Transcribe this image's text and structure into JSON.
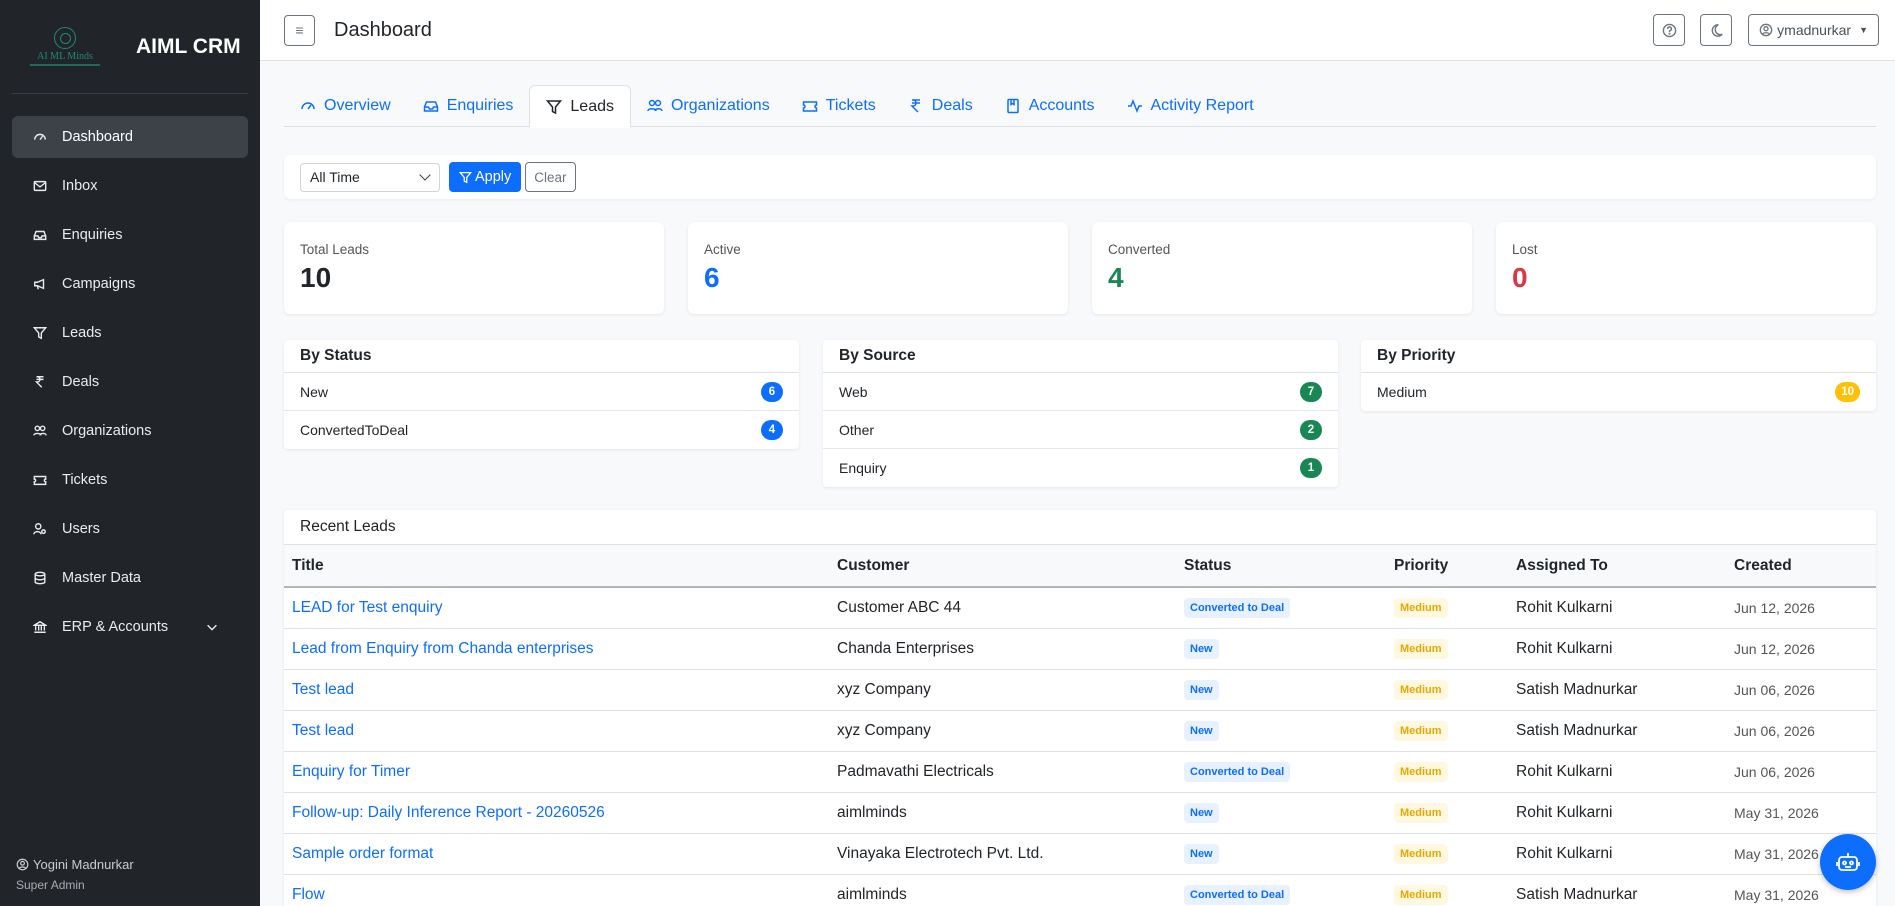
{
  "brand": {
    "logo_text": "AI ML Minds",
    "title": "AIML CRM"
  },
  "sidebar": {
    "items": [
      {
        "label": "Dashboard",
        "icon": "gauge-icon"
      },
      {
        "label": "Inbox",
        "icon": "envelope-icon"
      },
      {
        "label": "Enquiries",
        "icon": "inbox-tray-icon"
      },
      {
        "label": "Campaigns",
        "icon": "megaphone-icon"
      },
      {
        "label": "Leads",
        "icon": "funnel-icon"
      },
      {
        "label": "Deals",
        "icon": "rupee-icon"
      },
      {
        "label": "Organizations",
        "icon": "people-icon"
      },
      {
        "label": "Tickets",
        "icon": "ticket-icon"
      },
      {
        "label": "Users",
        "icon": "user-gear-icon"
      },
      {
        "label": "Master Data",
        "icon": "database-icon"
      },
      {
        "label": "ERP & Accounts",
        "icon": "bank-icon"
      }
    ],
    "user_name": "Yogini Madnurkar",
    "user_role": "Super Admin"
  },
  "topbar": {
    "title": "Dashboard",
    "user": "ymadnurkar"
  },
  "tabs": [
    "Overview",
    "Enquiries",
    "Leads",
    "Organizations",
    "Tickets",
    "Deals",
    "Accounts",
    "Activity Report"
  ],
  "filter": {
    "period": "All Time",
    "apply": "Apply",
    "clear": "Clear"
  },
  "stats": [
    {
      "label": "Total Leads",
      "value": "10",
      "color": "#212529"
    },
    {
      "label": "Active",
      "value": "6",
      "color": "#0d6efd"
    },
    {
      "label": "Converted",
      "value": "4",
      "color": "#198754"
    },
    {
      "label": "Lost",
      "value": "0",
      "color": "#dc3545"
    }
  ],
  "by_status": {
    "title": "By Status",
    "rows": [
      {
        "label": "New",
        "count": "6"
      },
      {
        "label": "ConvertedToDeal",
        "count": "4"
      }
    ]
  },
  "by_source": {
    "title": "By Source",
    "rows": [
      {
        "label": "Web",
        "count": "7"
      },
      {
        "label": "Other",
        "count": "2"
      },
      {
        "label": "Enquiry",
        "count": "1"
      }
    ]
  },
  "by_priority": {
    "title": "By Priority",
    "rows": [
      {
        "label": "Medium",
        "count": "10"
      }
    ]
  },
  "recent": {
    "title": "Recent Leads",
    "columns": [
      "Title",
      "Customer",
      "Status",
      "Priority",
      "Assigned To",
      "Created"
    ],
    "rows": [
      {
        "title": "LEAD for Test enquiry",
        "customer": "Customer ABC 44",
        "status": "Converted to Deal",
        "priority": "Medium",
        "assigned": "Rohit Kulkarni",
        "created": "Jun 12, 2026"
      },
      {
        "title": "Lead from Enquiry from Chanda enterprises",
        "customer": "Chanda Enterprises",
        "status": "New",
        "priority": "Medium",
        "assigned": "Rohit Kulkarni",
        "created": "Jun 12, 2026"
      },
      {
        "title": "Test lead",
        "customer": "xyz Company",
        "status": "New",
        "priority": "Medium",
        "assigned": "Satish Madnurkar",
        "created": "Jun 06, 2026"
      },
      {
        "title": "Test lead",
        "customer": "xyz Company",
        "status": "New",
        "priority": "Medium",
        "assigned": "Satish Madnurkar",
        "created": "Jun 06, 2026"
      },
      {
        "title": "Enquiry for Timer",
        "customer": "Padmavathi Electricals",
        "status": "Converted to Deal",
        "priority": "Medium",
        "assigned": "Rohit Kulkarni",
        "created": "Jun 06, 2026"
      },
      {
        "title": "Follow-up: Daily Inference Report - 20260526",
        "customer": "aimlminds",
        "status": "New",
        "priority": "Medium",
        "assigned": "Rohit Kulkarni",
        "created": "May 31, 2026"
      },
      {
        "title": "Sample order format",
        "customer": "Vinayaka Electrotech Pvt. Ltd.",
        "status": "New",
        "priority": "Medium",
        "assigned": "Rohit Kulkarni",
        "created": "May 31, 2026"
      },
      {
        "title": "Flow",
        "customer": "aimlminds",
        "status": "Converted to Deal",
        "priority": "Medium",
        "assigned": "Satish Madnurkar",
        "created": "May 31, 2026"
      }
    ]
  }
}
